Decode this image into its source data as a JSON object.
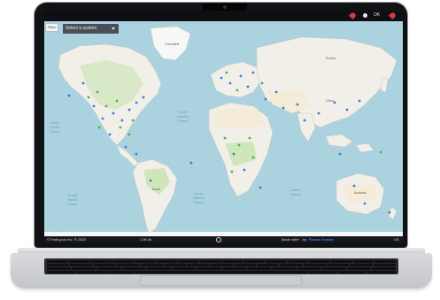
{
  "topbar": {
    "right_text": "OK"
  },
  "map_controls": {
    "pill_label": "Sites",
    "select_value": "Select a system"
  },
  "oceans": {
    "north_pacific": "North\nPacific\nOcean",
    "north_atlantic": "North\nAtlantic\nOcean",
    "south_pacific": "South\nPacific\nOcean",
    "south_atlantic": "South\nAtlantic\nOcean",
    "indian": "Indian\nOcean"
  },
  "places": {
    "greenland": "Greenland",
    "russia": "Russia",
    "china": "China",
    "brazil": "Brazil",
    "australia": "Australia"
  },
  "footer": {
    "left": "© Farbuyuto Inc. ® 2025",
    "middle": "1.96.4h",
    "center_icon": "help-icon",
    "made_with": "Made with",
    "by": "by",
    "author": "Ramon Grande",
    "right": "US"
  },
  "colors": {
    "ocean": "#aad3df",
    "land": "#f2efe9",
    "forest": "#cfe6b8",
    "desert": "#f4ecd6",
    "marker_blue": "#2f7fe0",
    "marker_green": "#3fb84f"
  }
}
